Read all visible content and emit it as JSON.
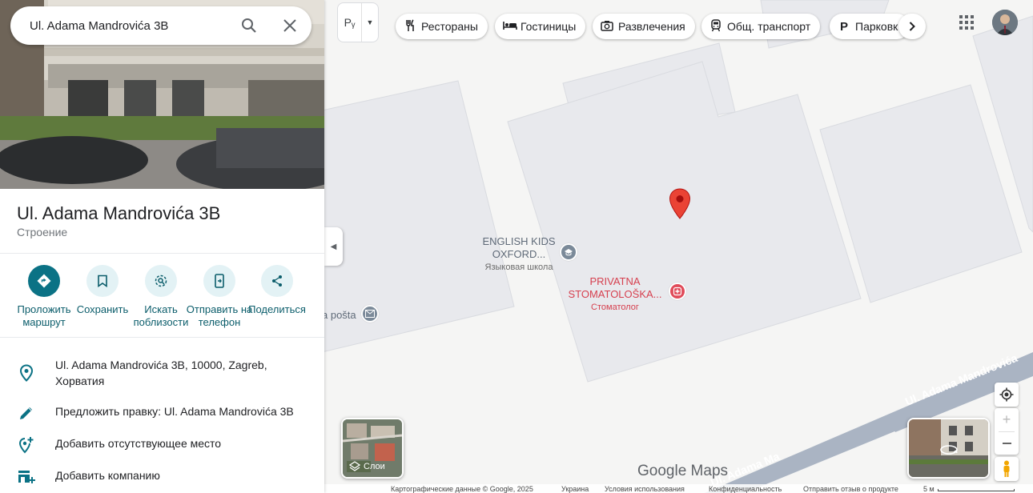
{
  "search": {
    "value": "Ul. Adama Mandrovića 3B"
  },
  "place": {
    "title": "Ul. Adama Mandrovića 3B",
    "category": "Строение"
  },
  "actions": [
    {
      "label": "Проложить маршрут"
    },
    {
      "label": "Сохранить"
    },
    {
      "label": "Искать поблизости"
    },
    {
      "label": "Отправить на телефон"
    },
    {
      "label": "Поделиться"
    }
  ],
  "info": {
    "address": "Ul. Adama Mandrovića 3B, 10000, Zagreb, Хорватия",
    "suggest_edit": "Предложить правку: Ul. Adama Mandrovića 3B",
    "add_place": "Добавить отсутствующее место",
    "add_business": "Добавить компанию"
  },
  "travel_mode": {
    "label": "Pᵧ"
  },
  "chips": [
    {
      "icon": "restaurant-icon",
      "label": "Рестораны"
    },
    {
      "icon": "hotel-icon",
      "label": "Гостиницы"
    },
    {
      "icon": "camera-icon",
      "label": "Развлечения"
    },
    {
      "icon": "transit-icon",
      "label": "Общ. транспорт"
    },
    {
      "icon": "parking-icon",
      "label": "Парковк"
    }
  ],
  "map": {
    "pois": [
      {
        "name": "ENGLISH KIDS OXFORD...",
        "type": "Языковая школа"
      },
      {
        "name": "PRIVATNA STOMATOLOŠKA...",
        "type": "Стоматолог"
      },
      {
        "name": "a pošta"
      }
    ],
    "street": "Ul. Adama Mandrovića",
    "street_cut": "Ul. Adama Ma"
  },
  "layers": {
    "label": "Слои"
  },
  "logo": "Google Maps",
  "footer": {
    "map_data": "Картографические данные © Google, 2025",
    "country": "Украина",
    "terms": "Условия использования",
    "privacy": "Конфиденциальность",
    "feedback": "Отправить отзыв о продукте",
    "scale": "5 м"
  },
  "colors": {
    "accent": "#0b7285",
    "pin": "#ea4335",
    "dentist": "#e04b5a",
    "school": "#7b8a99",
    "post": "#7b8a99"
  }
}
